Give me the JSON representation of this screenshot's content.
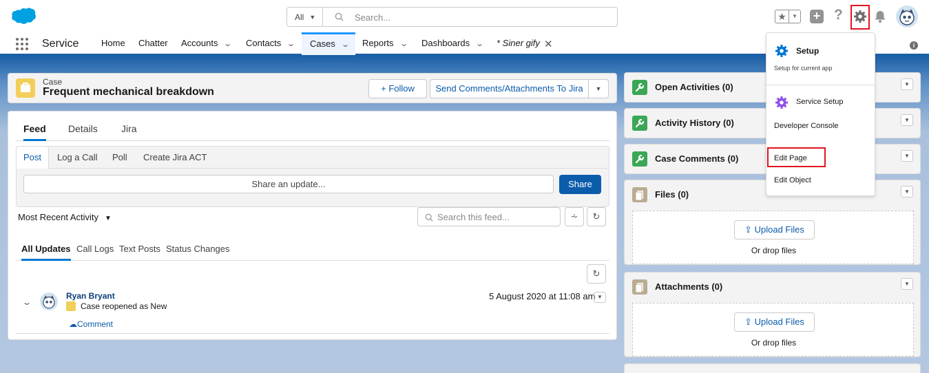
{
  "header": {
    "search_scope": "All",
    "search_placeholder": "Search..."
  },
  "nav": {
    "app_name": "Service",
    "items": [
      {
        "label": "Home",
        "has_menu": false
      },
      {
        "label": "Chatter",
        "has_menu": false
      },
      {
        "label": "Accounts",
        "has_menu": true
      },
      {
        "label": "Contacts",
        "has_menu": true
      },
      {
        "label": "Cases",
        "has_menu": true,
        "active": true
      },
      {
        "label": "Reports",
        "has_menu": true
      },
      {
        "label": "Dashboards",
        "has_menu": true
      },
      {
        "label": "* Siner gify",
        "has_menu": false,
        "closable": true
      }
    ]
  },
  "record": {
    "type": "Case",
    "title": "Frequent mechanical breakdown",
    "follow_label": "+ Follow",
    "jira_label": "Send Comments/Attachments To Jira"
  },
  "feed": {
    "tabs": [
      "Feed",
      "Details",
      "Jira"
    ],
    "publisher_tabs": [
      "Post",
      "Log a Call",
      "Poll",
      "Create Jira ACT"
    ],
    "share_placeholder": "Share an update...",
    "share_button": "Share",
    "sort_label": "Most Recent Activity",
    "search_placeholder": "Search this feed...",
    "filters": [
      "All Updates",
      "Call Logs",
      "Text Posts",
      "Status Changes"
    ],
    "post": {
      "author": "Ryan Bryant",
      "text": "Case reopened as New",
      "time": "5 August 2020 at 11:08 am",
      "comment_label": "Comment"
    }
  },
  "panels": [
    {
      "title": "Open Activities (0)",
      "icon": "wrench-icon",
      "color": "#3ba755"
    },
    {
      "title": "Activity History (0)",
      "icon": "wrench-icon",
      "color": "#3ba755"
    },
    {
      "title": "Case Comments (0)",
      "icon": "wrench-icon",
      "color": "#3ba755"
    },
    {
      "title": "Files (0)",
      "icon": "file-icon",
      "color": "#baac93",
      "upload_label": "Upload Files",
      "drop_label": "Or drop files"
    },
    {
      "title": "Attachments (0)",
      "icon": "file-icon",
      "color": "#baac93",
      "upload_label": "Upload Files",
      "drop_label": "Or drop files"
    }
  ],
  "setup_menu": {
    "setup_title": "Setup",
    "setup_sub": "Setup for current app",
    "service_setup": "Service Setup",
    "developer_console": "Developer Console",
    "edit_page": "Edit Page",
    "edit_object": "Edit Object"
  },
  "colors": {
    "brand_blue": "#0b5cab",
    "highlight_red": "#e0141e",
    "case_yellow": "#f2cf5b"
  }
}
